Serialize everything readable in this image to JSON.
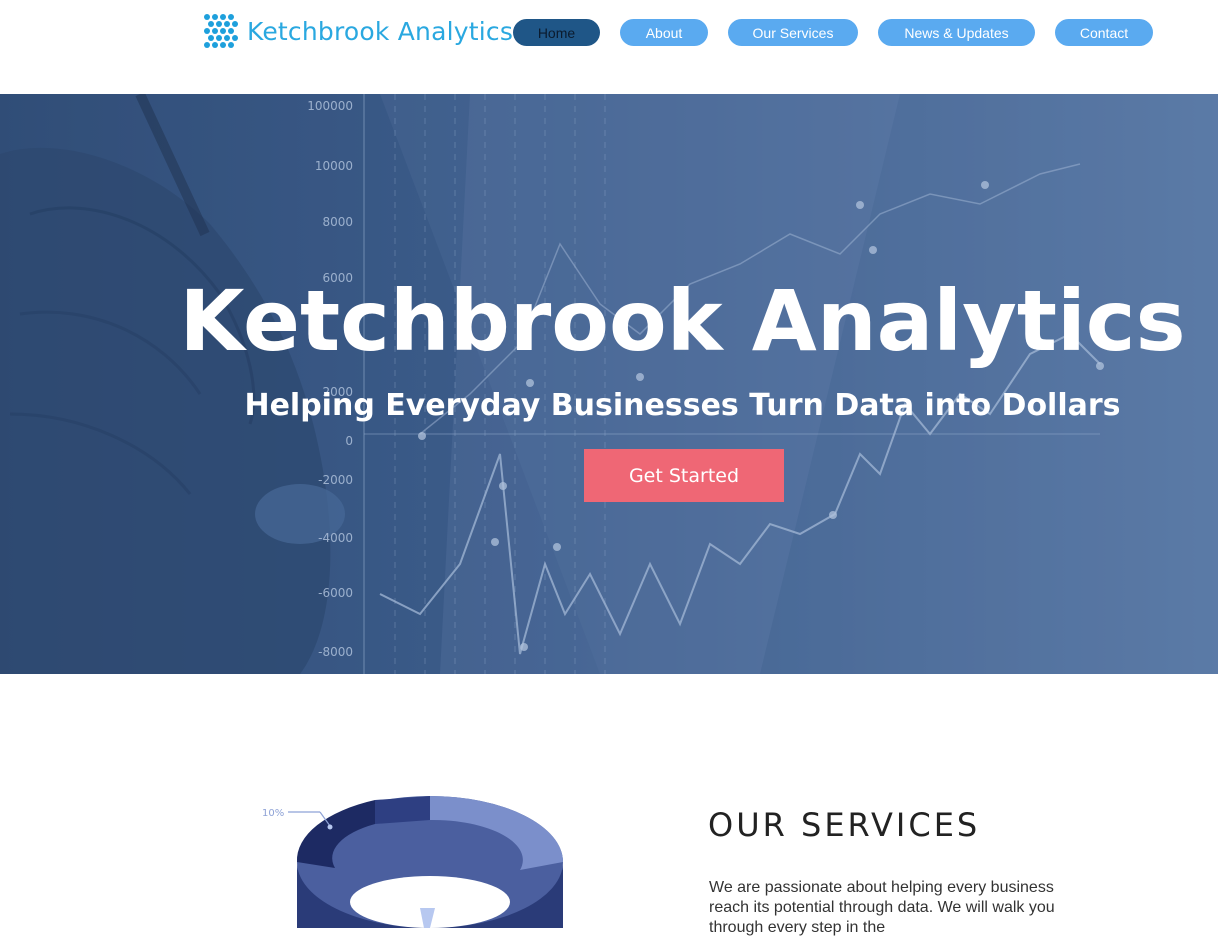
{
  "header": {
    "brand": "Ketchbrook Analytics",
    "logo_icon": "dot-grid-logo-icon",
    "nav": [
      {
        "label": "Home",
        "active": true
      },
      {
        "label": "About",
        "active": false
      },
      {
        "label": "Our Services",
        "active": false
      },
      {
        "label": "News & Updates",
        "active": false
      },
      {
        "label": "Contact",
        "active": false
      }
    ]
  },
  "hero": {
    "title": "Ketchbrook Analytics",
    "subtitle": "Helping Everyday Businesses Turn Data into Dollars",
    "cta_label": "Get Started",
    "axis_ticks": [
      "100000",
      "10000",
      "8000",
      "6000",
      "2000",
      "0",
      "-2000",
      "-4000",
      "-6000",
      "-8000"
    ]
  },
  "services": {
    "title": "OUR SERVICES",
    "body": "We are passionate about helping every business reach its potential through data.  We will walk you through every step in the",
    "chart_label": "10%"
  },
  "colors": {
    "brand": "#2aa8e0",
    "nav_button": "#5aaaf0",
    "nav_active": "#1f5687",
    "cta": "#ef6775",
    "hero_overlay": "#3f5f8f"
  }
}
